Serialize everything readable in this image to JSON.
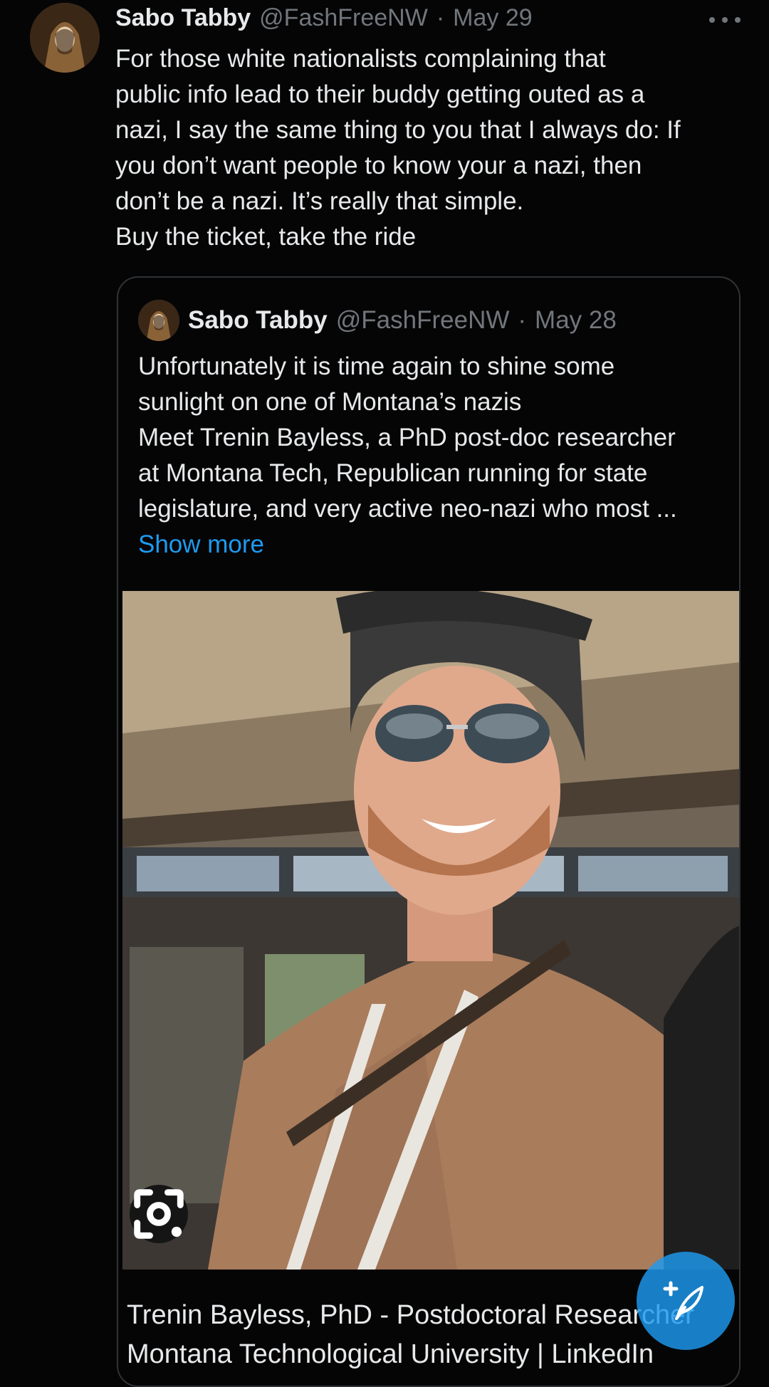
{
  "tweet": {
    "author_name": "Sabo Tabby",
    "handle": "@FashFreeNW",
    "separator": "·",
    "date": "May 29",
    "text_lines": [
      "For those white nationalists  complaining that",
      "public info lead to their buddy getting outed as a",
      "nazi, I say the same thing to you that I always do: If",
      "you don’t want people to know your a nazi, then",
      "don’t be a nazi. It’s really that simple.",
      "Buy the ticket, take the ride"
    ],
    "more_icon": "more-horizontal-icon"
  },
  "quoted_tweet": {
    "author_name": "Sabo Tabby",
    "handle": "@FashFreeNW",
    "separator": "·",
    "date": "May 28",
    "text_lines": [
      "Unfortunately it is time again to shine some",
      "sunlight on one of Montana’s nazis",
      "Meet Trenin Bayless, a PhD post-doc researcher",
      "at Montana Tech, Republican running for state",
      "legislature, and very active neo-nazi who most ..."
    ],
    "show_more": "Show more",
    "media_icon": "lens-search-icon",
    "link_caption_lines": [
      "Trenin Bayless, PhD - Postdoctoral Researcher",
      "Montana Technological University | LinkedIn"
    ]
  },
  "compose_button": {
    "icon": "compose-feather-icon"
  },
  "colors": {
    "background": "#050506",
    "text": "#e7e9ea",
    "secondary_text": "#71767b",
    "accent": "#1d9bf0",
    "border": "#2f3336"
  }
}
